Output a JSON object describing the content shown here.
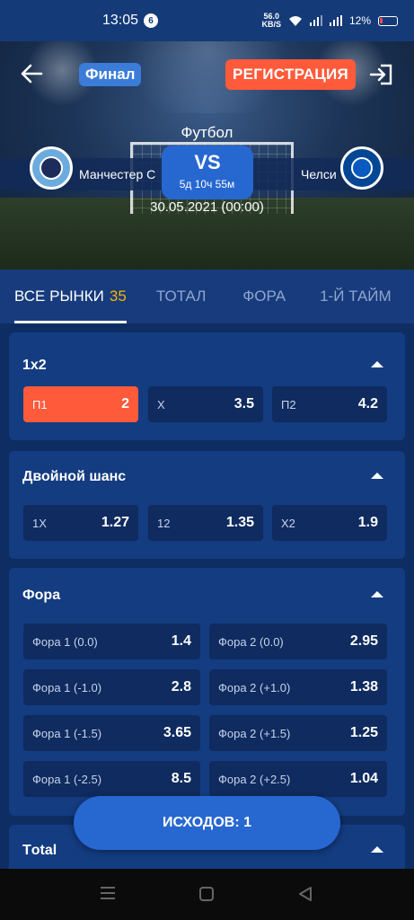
{
  "status": {
    "time": "13:05",
    "notif_count": "6",
    "net_speed_top": "56.0",
    "net_speed_unit": "KB/S",
    "battery": "12%"
  },
  "header": {
    "stage": "Финал",
    "register": "РЕГИСТРАЦИЯ"
  },
  "match": {
    "sport": "Футбол",
    "home": "Манчестер С",
    "away": "Челси",
    "vs": "VS",
    "countdown": "5д 10ч 55м",
    "date": "30.05.2021 (00:00)"
  },
  "tabs": [
    {
      "label": "ВСЕ РЫНКИ",
      "count": "35"
    },
    {
      "label": "ТОТАЛ"
    },
    {
      "label": "ФОРА"
    },
    {
      "label": "1-Й ТАЙМ"
    }
  ],
  "markets": {
    "m1x2": {
      "title": "1x2",
      "odds": [
        {
          "label": "П1",
          "value": "2"
        },
        {
          "label": "X",
          "value": "3.5"
        },
        {
          "label": "П2",
          "value": "4.2"
        }
      ]
    },
    "double": {
      "title": "Двойной шанс",
      "odds": [
        {
          "label": "1X",
          "value": "1.27"
        },
        {
          "label": "12",
          "value": "1.35"
        },
        {
          "label": "X2",
          "value": "1.9"
        }
      ]
    },
    "fora": {
      "title": "Фора",
      "odds": [
        {
          "label": "Фора 1 (0.0)",
          "value": "1.4"
        },
        {
          "label": "Фора 2 (0.0)",
          "value": "2.95"
        },
        {
          "label": "Фора 1 (-1.0)",
          "value": "2.8"
        },
        {
          "label": "Фора 2 (+1.0)",
          "value": "1.38"
        },
        {
          "label": "Фора 1 (-1.5)",
          "value": "3.65"
        },
        {
          "label": "Фора 2 (+1.5)",
          "value": "1.25"
        },
        {
          "label": "Фора 1 (-2.5)",
          "value": "8.5"
        },
        {
          "label": "Фора 2 (+2.5)",
          "value": "1.04"
        }
      ]
    },
    "total": {
      "title": "Тotal"
    }
  },
  "outcomes_button": "ИСХОДОВ: 1",
  "colors": {
    "accent": "#ff5a3a",
    "primary": "#2767d0",
    "background": "#0e2d63",
    "tab_count": "#f5b400"
  }
}
